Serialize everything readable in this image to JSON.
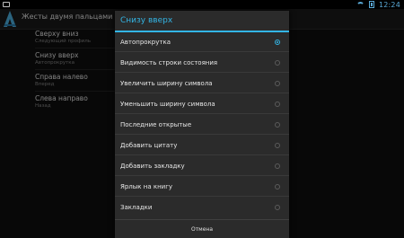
{
  "status_bar": {
    "time": "12:24"
  },
  "app_bar": {
    "title": "Жесты двумя пальцами"
  },
  "background_list": [
    {
      "title": "Сверху вниз",
      "subtitle": "Следующий профиль"
    },
    {
      "title": "Снизу вверх",
      "subtitle": "Автопрокрутка"
    },
    {
      "title": "Справа налево",
      "subtitle": "Вперед"
    },
    {
      "title": "Слева направо",
      "subtitle": "Назад"
    }
  ],
  "dialog": {
    "title": "Снизу вверх",
    "options": [
      {
        "label": "Автопрокрутка",
        "selected": true
      },
      {
        "label": "Видимость строки состояния",
        "selected": false
      },
      {
        "label": "Увеличить ширину символа",
        "selected": false
      },
      {
        "label": "Уменьшить ширину символа",
        "selected": false
      },
      {
        "label": "Последние открытые",
        "selected": false
      },
      {
        "label": "Добавить цитату",
        "selected": false
      },
      {
        "label": "Добавить закладку",
        "selected": false
      },
      {
        "label": "Ярлык на книгу",
        "selected": false
      },
      {
        "label": "Закладки",
        "selected": false
      }
    ],
    "cancel_label": "Отмена"
  },
  "colors": {
    "accent": "#33b5e5",
    "dialog_bg": "#2b2b2b",
    "screen_bg": "#0f0f0f"
  }
}
